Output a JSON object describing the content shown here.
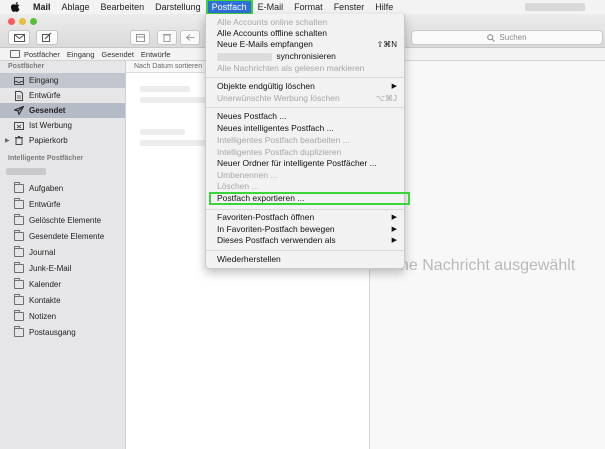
{
  "menubar": {
    "apple_icon": "apple-logo-icon",
    "items": [
      "Mail",
      "Ablage",
      "Bearbeiten",
      "Darstellung",
      "Postfach",
      "E-Mail",
      "Format",
      "Fenster",
      "Hilfe"
    ],
    "active": "Postfach"
  },
  "window": {
    "search_placeholder": "Suchen",
    "favorites": {
      "mailboxes": "Postfächer",
      "inbox": "Eingang",
      "sent": "Gesendet",
      "drafts": "Entwürfe"
    },
    "traffic_colors": [
      "#fc5b57",
      "#e5bf3c",
      "#57c038"
    ]
  },
  "sidebar": {
    "section_mailboxes": "Postfächer",
    "mailboxes": [
      {
        "label": "Eingang",
        "icon": "inbox-tray-icon"
      },
      {
        "label": "Entwürfe",
        "icon": "document-icon"
      },
      {
        "label": "Gesendet",
        "icon": "paper-plane-icon"
      },
      {
        "label": "Ist Werbung",
        "icon": "junk-tray-icon"
      },
      {
        "label": "Papierkorb",
        "icon": "trash-icon"
      }
    ],
    "section_smart": "Intelligente Postfächer",
    "folders": [
      "Aufgaben",
      "Entwürfe",
      "Gelöschte Elemente",
      "Gesendete Elemente",
      "Journal",
      "Junk-E-Mail",
      "Kalender",
      "Kontakte",
      "Notizen",
      "Postausgang"
    ]
  },
  "list": {
    "sort_label": "Nach Datum sortieren"
  },
  "viewer": {
    "empty_text": "ne Nachricht ausgewählt"
  },
  "postfach_menu": {
    "items": [
      {
        "label": "Alle Accounts online schalten",
        "disabled": true
      },
      {
        "label": "Alle Accounts offline schalten",
        "disabled": false
      },
      {
        "label": "Neue E-Mails empfangen",
        "disabled": false,
        "shortcut": "⇧⌘N"
      },
      {
        "label": "synchronisieren",
        "disabled": false
      },
      {
        "label": "Alle Nachrichten als gelesen markieren",
        "disabled": true
      },
      {
        "label": "Objekte endgültig löschen",
        "disabled": false,
        "submenu": true
      },
      {
        "label": "Unerwünschte Werbung löschen",
        "disabled": true,
        "shortcut": "⌥⌘J"
      },
      {
        "label": "Neues Postfach ...",
        "disabled": false
      },
      {
        "label": "Neues intelligentes Postfach ...",
        "disabled": false
      },
      {
        "label": "Intelligentes Postfach bearbeiten ...",
        "disabled": true
      },
      {
        "label": "Intelligentes Postfach duplizieren",
        "disabled": true
      },
      {
        "label": "Neuer Ordner für intelligente Postfächer ...",
        "disabled": false
      },
      {
        "label": "Umbenennen ...",
        "disabled": true
      },
      {
        "label": "Löschen ...",
        "disabled": true
      },
      {
        "label": "Postfach exportieren ...",
        "disabled": false,
        "highlighted": true
      },
      {
        "label": "Favoriten-Postfach öffnen",
        "disabled": false,
        "submenu": true
      },
      {
        "label": "In Favoriten-Postfach bewegen",
        "disabled": false,
        "submenu": true
      },
      {
        "label": "Dieses Postfach verwenden als",
        "disabled": false,
        "submenu": true
      },
      {
        "label": "Wiederherstellen",
        "disabled": false
      }
    ],
    "submenu_glyph": "▶"
  }
}
